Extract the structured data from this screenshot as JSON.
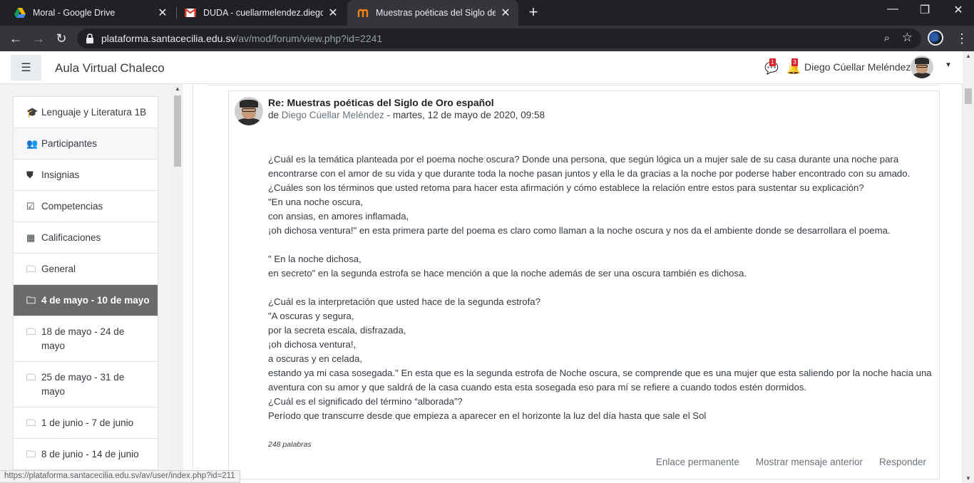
{
  "browser": {
    "tabs": [
      {
        "title": "Moral - Google Drive",
        "icon": "google-drive-icon"
      },
      {
        "title": "DUDA - cuellarmelendez.diego@",
        "icon": "gmail-icon"
      },
      {
        "title": "Muestras poéticas del Siglo de Oro",
        "icon": "moodle-icon",
        "active": true
      }
    ],
    "url_host": "plataforma.santacecilia.edu.sv",
    "url_path": "/av/mod/forum/view.php?id=2241",
    "status_url": "https://plataforma.santacecilia.edu.sv/av/user/index.php?id=211"
  },
  "header": {
    "site_name": "Aula Virtual Chaleco",
    "messages_count": "1",
    "notifications_count": "3",
    "user_name": "Diego Cúellar Meléndez"
  },
  "nav": {
    "items": [
      {
        "icon": "graduation-cap-icon",
        "glyph": "🎓",
        "label": "Lenguaje y Literatura 1B"
      },
      {
        "icon": "users-icon",
        "glyph": "👥",
        "label": "Participantes"
      },
      {
        "icon": "shield-icon",
        "glyph": "⛊",
        "label": "Insignias"
      },
      {
        "icon": "checkbox-icon",
        "glyph": "☑",
        "label": "Competencias"
      },
      {
        "icon": "table-icon",
        "glyph": "▦",
        "label": "Calificaciones"
      },
      {
        "icon": "folder-icon",
        "glyph": "🗀",
        "label": "General"
      },
      {
        "icon": "folder-icon",
        "glyph": "🗀",
        "label": "4 de mayo - 10 de mayo",
        "active": true
      },
      {
        "icon": "folder-icon",
        "glyph": "🗀",
        "label": "18 de mayo - 24 de mayo"
      },
      {
        "icon": "folder-icon",
        "glyph": "🗀",
        "label": "25 de mayo - 31 de mayo"
      },
      {
        "icon": "folder-icon",
        "glyph": "🗀",
        "label": "1 de junio - 7 de junio"
      },
      {
        "icon": "folder-icon",
        "glyph": "🗀",
        "label": "8 de junio - 14 de junio"
      }
    ]
  },
  "post": {
    "subject": "Re: Muestras poéticas del Siglo de Oro español",
    "by_prefix": "de ",
    "author": "Diego Cúellar Meléndez",
    "date": " - martes, 12 de mayo de 2020, 09:58",
    "paragraphs": [
      "¿Cuál es la temática planteada por el poema noche oscura? Donde una persona, que según lógica un a mujer sale de su casa durante una noche para encontrarse con el amor de su vida y que durante toda la noche pasan juntos y ella le da gracias a la noche por poderse haber encontrado con su amado.",
      "¿Cuáles son los términos que usted retoma para hacer esta afirmación y cómo establece la relación entre estos para sustentar su explicación?",
      "\"En una noche oscura,",
      "con ansias, en amores inflamada,",
      "¡oh dichosa ventura!\" en esta primera parte del poema es claro como llaman a la noche oscura y nos da el ambiente donde se desarrollara el poema.",
      "",
      "\" En la noche dichosa,",
      "en secreto\" en la segunda estrofa se hace mención a que la noche además de ser una oscura también es dichosa.",
      "",
      "¿Cuál es la interpretación que usted hace de la segunda estrofa?",
      "\"A oscuras y segura,",
      "por la secreta escala, disfrazada,",
      "¡oh dichosa ventura!,",
      "a oscuras y en celada,",
      "estando ya mi casa sosegada.\" En esta que es la segunda estrofa de Noche oscura, se comprende que es una mujer que esta saliendo por la noche hacia una aventura con su amor y que saldrá de la casa cuando esta esta sosegada eso para mí se refiere a cuando todos estén dormidos.",
      "¿Cuál es el significado del término “alborada”?",
      "Período que transcurre desde que empieza a aparecer en el horizonte la luz del día hasta que sale el Sol"
    ],
    "word_count": "248 palabras",
    "actions": [
      "Enlace permanente",
      "Mostrar mensaje anterior",
      "Responder"
    ]
  }
}
